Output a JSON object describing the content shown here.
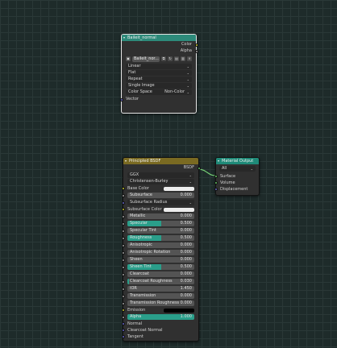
{
  "colors": {
    "texture_header": "#2d8a7a",
    "shader_header": "#7a6a22",
    "output_header": "#1f8a78",
    "slider_fill": "#2a9e8a"
  },
  "image_node": {
    "title": "Baileit_normal",
    "outputs": [
      "Color",
      "Alpha"
    ],
    "image_name": "Baileit_nor...",
    "interpolation": "Linear",
    "projection": "Flat",
    "extension": "Repeat",
    "source": "Single Image",
    "color_space_label": "Color Space",
    "color_space_value": "Non-Color",
    "input": "Vector"
  },
  "bsdf_node": {
    "title": "Principled BSDF",
    "output": "BSDF",
    "distribution": "GGX",
    "subsurface_method": "Christensen-Burley",
    "base_color_label": "Base Color",
    "subsurface_label": "Subsurface",
    "subsurface_value": "0.000",
    "subsurface_radius_label": "Subsurface Radius",
    "subsurface_color_label": "Subsurface Color",
    "sliders": [
      {
        "label": "Metallic",
        "value": "0.000",
        "fill": 0
      },
      {
        "label": "Specular",
        "value": "0.500",
        "fill": 0.5
      },
      {
        "label": "Specular Tint",
        "value": "0.000",
        "fill": 0
      },
      {
        "label": "Roughness",
        "value": "0.500",
        "fill": 0.5
      },
      {
        "label": "Anisotropic",
        "value": "0.000",
        "fill": 0
      },
      {
        "label": "Anisotropic Rotation",
        "value": "0.000",
        "fill": 0
      },
      {
        "label": "Sheen",
        "value": "0.000",
        "fill": 0
      },
      {
        "label": "Sheen Tint",
        "value": "0.500",
        "fill": 0.5
      },
      {
        "label": "Clearcoat",
        "value": "0.000",
        "fill": 0
      },
      {
        "label": "Clearcoat Roughness",
        "value": "0.030",
        "fill": 0.03
      },
      {
        "label": "IOR",
        "value": "1.450",
        "fill": 0
      },
      {
        "label": "Transmission",
        "value": "0.000",
        "fill": 0
      },
      {
        "label": "Transmission Roughness",
        "value": "0.000",
        "fill": 0
      }
    ],
    "emission_label": "Emission",
    "alpha_label": "Alpha",
    "alpha_value": "1.000",
    "normal_label": "Normal",
    "clearcoat_normal_label": "Clearcoat Normal",
    "tangent_label": "Tangent"
  },
  "output_node": {
    "title": "Material Output",
    "target": "All",
    "inputs": [
      "Surface",
      "Volume",
      "Displacement"
    ]
  }
}
